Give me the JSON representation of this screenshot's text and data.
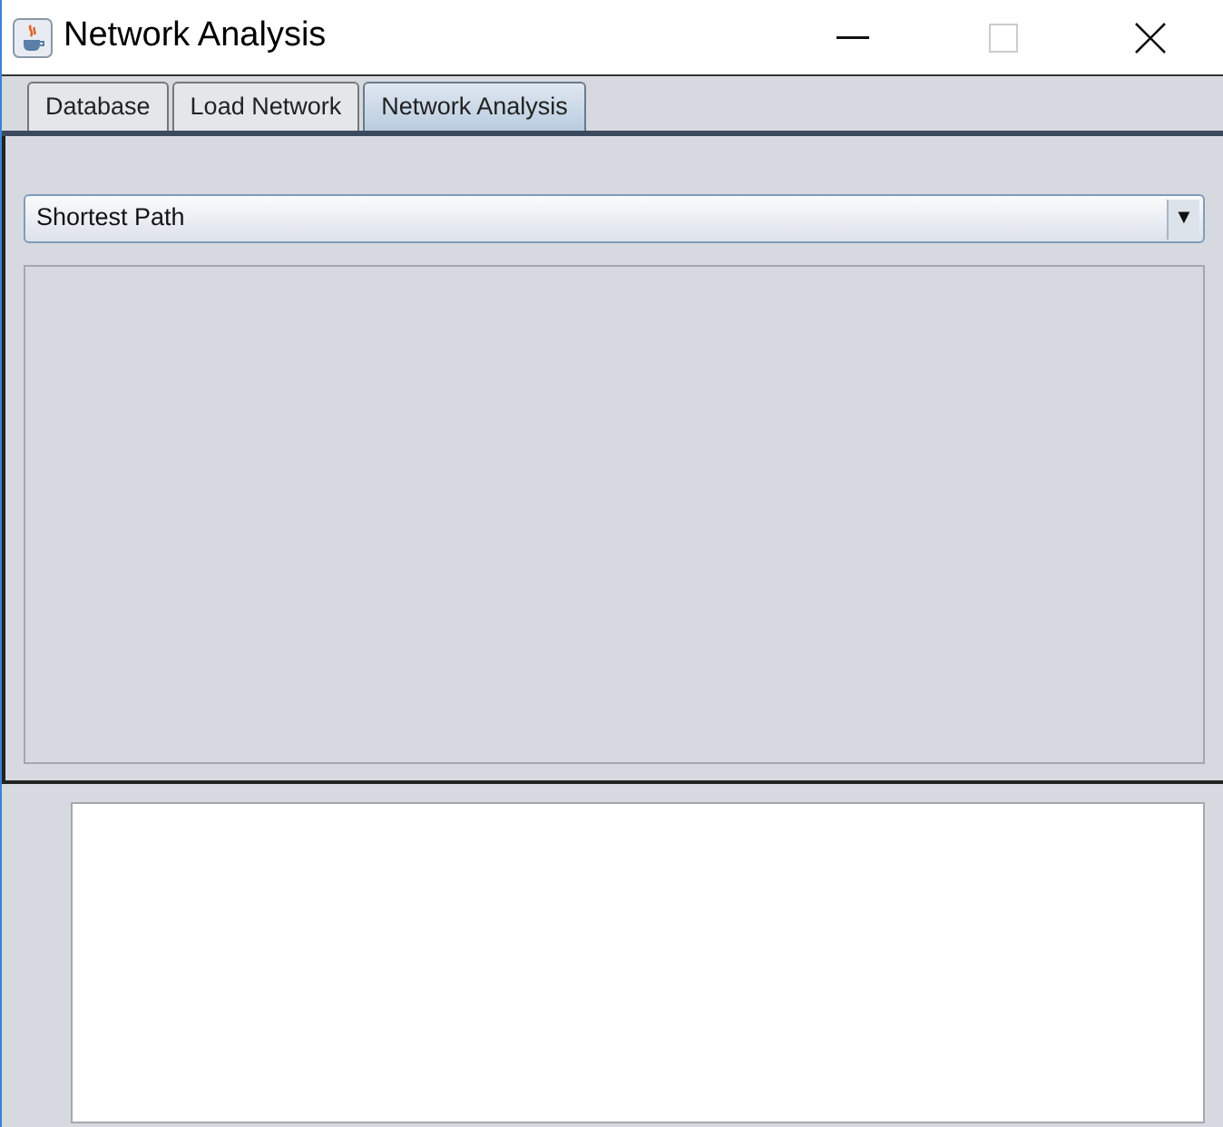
{
  "window": {
    "title": "Network Analysis"
  },
  "tabs": [
    {
      "label": "Database",
      "selected": false
    },
    {
      "label": "Load Network",
      "selected": false
    },
    {
      "label": "Network Analysis",
      "selected": true
    }
  ],
  "analysis_dropdown": {
    "value": "Shortest Path",
    "arrow": "▼"
  }
}
